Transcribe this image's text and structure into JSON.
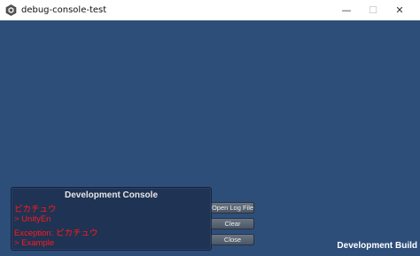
{
  "window": {
    "title": "debug-console-test",
    "controls": {
      "minimize": "—",
      "maximize": "☐",
      "close": "✕"
    }
  },
  "console": {
    "title": "Development Console",
    "lines": [
      {
        "text": "ピカチュウ"
      },
      {
        "text": "> UnityEn"
      },
      {
        "text": "Exception: ピカチュウ"
      },
      {
        "text": "> Example"
      }
    ],
    "log_color": "#ff1a1a",
    "buttons": {
      "open_log": "Open Log File",
      "clear": "Clear",
      "close": "Close"
    }
  },
  "build_badge": "Development Build",
  "colors": {
    "viewport_bg": "#2e4e7a",
    "console_bg": "#1f3354"
  },
  "icons": {
    "app": "unity-logo-icon"
  }
}
